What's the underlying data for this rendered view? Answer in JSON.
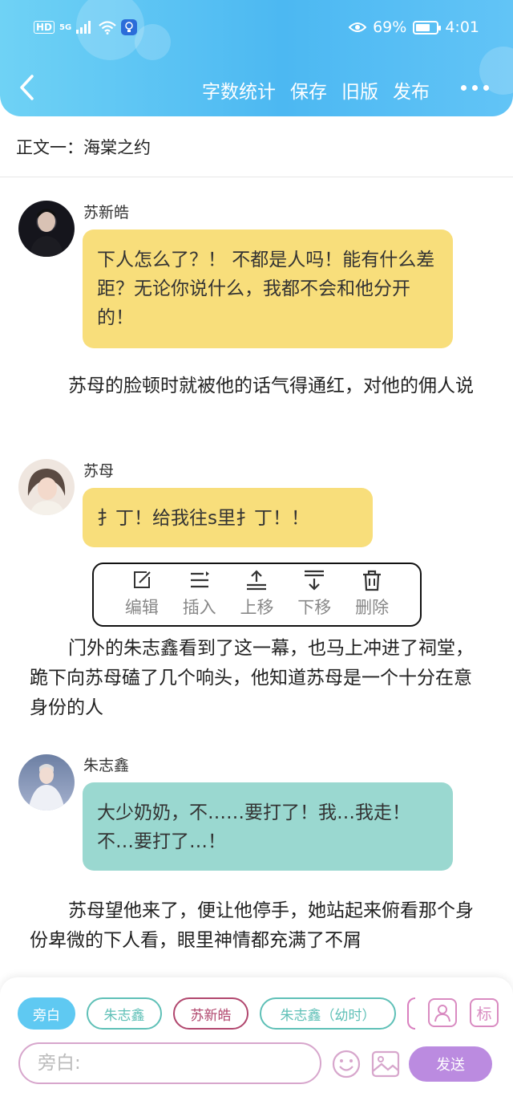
{
  "status_bar": {
    "hd": "HD",
    "network": "5G",
    "battery_text": "69%",
    "battery_level": 0.69,
    "time": "4:01"
  },
  "nav": {
    "actions": [
      "字数统计",
      "保存",
      "旧版",
      "发布"
    ]
  },
  "chapter": {
    "title": "正文一：海棠之约"
  },
  "messages": [
    {
      "speaker": "苏新皓",
      "text": "下人怎么了？！ 不都是人吗！能有什么差距？无论你说什么，我都不会和他分开的！",
      "color": "#f8de7b"
    },
    {
      "narration": "苏母的脸顿时就被他的话气得通红，对他的佣人说"
    },
    {
      "speaker": "苏母",
      "text": "扌丁！给我往s里扌丁！！",
      "color": "#f8de7b"
    },
    {
      "narration": "门外的朱志鑫看到了这一幕，也马上冲进了祠堂，跪下向苏母磕了几个响头，他知道苏母是一个十分在意身份的人"
    },
    {
      "speaker": "朱志鑫",
      "text": "大少奶奶，不……要打了！我…我走！不…要打了…！",
      "color": "#9ad8d0"
    },
    {
      "narration": "苏母望他来了，便让他停手，她站起来俯看那个身份卑微的下人看，眼里神情都充满了不屑"
    }
  ],
  "context_menu": {
    "items": [
      {
        "label": "编辑",
        "icon": "edit-icon"
      },
      {
        "label": "插入",
        "icon": "insert-icon"
      },
      {
        "label": "上移",
        "icon": "move-up-icon"
      },
      {
        "label": "下移",
        "icon": "move-down-icon"
      },
      {
        "label": "删除",
        "icon": "delete-icon"
      }
    ]
  },
  "composer": {
    "roles": [
      "旁白",
      "朱志鑫",
      "苏新皓",
      "朱志鑫（幼时）"
    ],
    "active_role": "旁白",
    "input_placeholder": "旁白:",
    "tag_button": "标",
    "send_label": "发送"
  },
  "colors": {
    "header_gradient": [
      "#6fd2f5",
      "#4cb8f2"
    ],
    "yellow_bubble": "#f8de7b",
    "teal_bubble": "#9ad8d0",
    "send_button": "#bb8be0",
    "active_tag": "#5fc9f2"
  }
}
